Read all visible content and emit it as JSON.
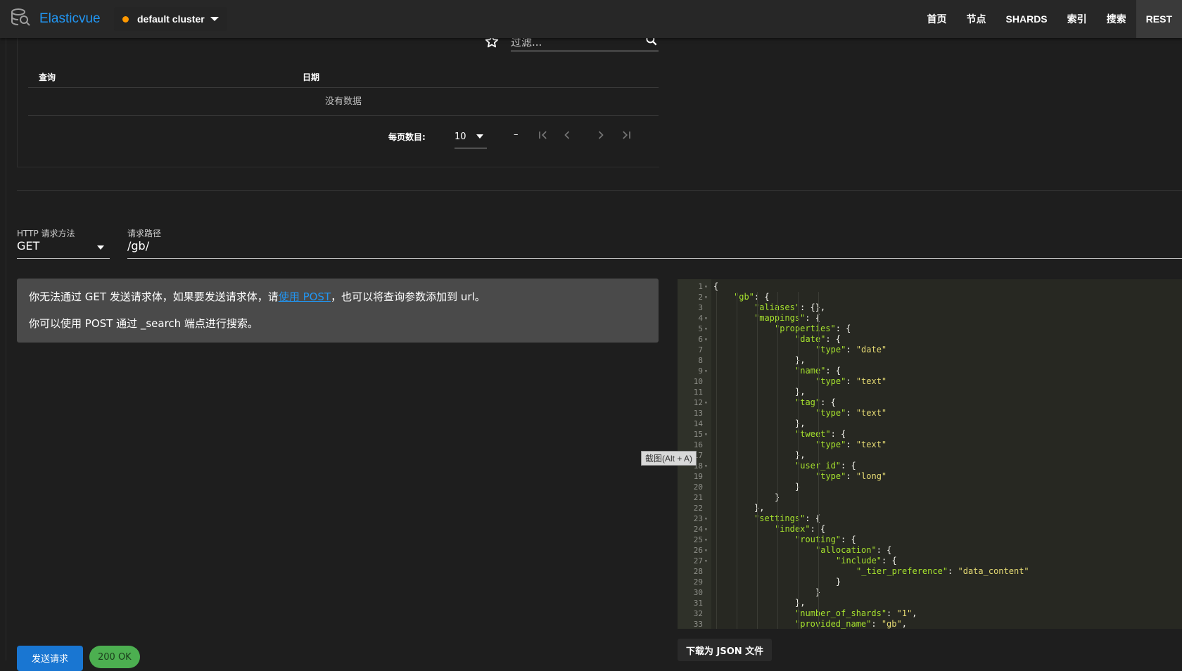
{
  "app": {
    "name": "Elasticvue",
    "cluster": "default cluster",
    "cluster_status_color": "#ff9800",
    "brand_color": "#2196f3"
  },
  "nav": [
    {
      "label": "首页",
      "active": false
    },
    {
      "label": "节点",
      "active": false
    },
    {
      "label": "SHARDS",
      "active": false
    },
    {
      "label": "索引",
      "active": false
    },
    {
      "label": "搜索",
      "active": false
    },
    {
      "label": "REST",
      "active": true
    }
  ],
  "history": {
    "filter_placeholder": "过滤...",
    "columns": [
      "查询",
      "日期"
    ],
    "empty_text": "没有数据",
    "per_page_label": "每页数目:",
    "per_page_value": "10",
    "range_text": "–"
  },
  "request": {
    "method_label": "HTTP 请求方法",
    "method_value": "GET",
    "path_label": "请求路径",
    "path_value": "/gb/"
  },
  "alert": {
    "line1_before": "你无法通过 GET 发送请求体，如果要发送请求体，请",
    "line1_link": "使用 POST",
    "line1_after": "，也可以将查询参数添加到 url。",
    "line2": "你可以使用 POST 通过 _search 端点进行搜索。"
  },
  "editor": {
    "lines": [
      {
        "n": "1",
        "fold": true,
        "ind": 0,
        "text": "{"
      },
      {
        "n": "2",
        "fold": true,
        "ind": 1,
        "key": "\"gb\"",
        "text": ": {"
      },
      {
        "n": "3",
        "fold": false,
        "ind": 2,
        "key": "\"aliases\"",
        "text": ": {},"
      },
      {
        "n": "4",
        "fold": true,
        "ind": 2,
        "key": "\"mappings\"",
        "text": ": {"
      },
      {
        "n": "5",
        "fold": true,
        "ind": 3,
        "key": "\"properties\"",
        "text": ": {"
      },
      {
        "n": "6",
        "fold": true,
        "ind": 4,
        "key": "\"date\"",
        "text": ": {"
      },
      {
        "n": "7",
        "fold": false,
        "ind": 5,
        "key": "\"type\"",
        "text": ": ",
        "str": "\"date\""
      },
      {
        "n": "8",
        "fold": false,
        "ind": 4,
        "text": "},"
      },
      {
        "n": "9",
        "fold": true,
        "ind": 4,
        "key": "\"name\"",
        "text": ": {"
      },
      {
        "n": "10",
        "fold": false,
        "ind": 5,
        "key": "\"type\"",
        "text": ": ",
        "str": "\"text\""
      },
      {
        "n": "11",
        "fold": false,
        "ind": 4,
        "text": "},"
      },
      {
        "n": "12",
        "fold": true,
        "ind": 4,
        "key": "\"tag\"",
        "text": ": {"
      },
      {
        "n": "13",
        "fold": false,
        "ind": 5,
        "key": "\"type\"",
        "text": ": ",
        "str": "\"text\""
      },
      {
        "n": "14",
        "fold": false,
        "ind": 4,
        "text": "},"
      },
      {
        "n": "15",
        "fold": true,
        "ind": 4,
        "key": "\"tweet\"",
        "text": ": {"
      },
      {
        "n": "16",
        "fold": false,
        "ind": 5,
        "key": "\"type\"",
        "text": ": ",
        "str": "\"text\""
      },
      {
        "n": "17",
        "fold": false,
        "ind": 4,
        "text": "},"
      },
      {
        "n": "18",
        "fold": true,
        "ind": 4,
        "key": "\"user_id\"",
        "text": ": {"
      },
      {
        "n": "19",
        "fold": false,
        "ind": 5,
        "key": "\"type\"",
        "text": ": ",
        "str": "\"long\""
      },
      {
        "n": "20",
        "fold": false,
        "ind": 4,
        "text": "}"
      },
      {
        "n": "21",
        "fold": false,
        "ind": 3,
        "text": "}"
      },
      {
        "n": "22",
        "fold": false,
        "ind": 2,
        "text": "},"
      },
      {
        "n": "23",
        "fold": true,
        "ind": 2,
        "key": "\"settings\"",
        "text": ": {"
      },
      {
        "n": "24",
        "fold": true,
        "ind": 3,
        "key": "\"index\"",
        "text": ": {"
      },
      {
        "n": "25",
        "fold": true,
        "ind": 4,
        "key": "\"routing\"",
        "text": ": {"
      },
      {
        "n": "26",
        "fold": true,
        "ind": 5,
        "key": "\"allocation\"",
        "text": ": {"
      },
      {
        "n": "27",
        "fold": true,
        "ind": 6,
        "key": "\"include\"",
        "text": ": {"
      },
      {
        "n": "28",
        "fold": false,
        "ind": 7,
        "key": "\"_tier_preference\"",
        "text": ": ",
        "str": "\"data_content\""
      },
      {
        "n": "29",
        "fold": false,
        "ind": 6,
        "text": "}"
      },
      {
        "n": "30",
        "fold": false,
        "ind": 5,
        "text": "}"
      },
      {
        "n": "31",
        "fold": false,
        "ind": 4,
        "text": "},"
      },
      {
        "n": "32",
        "fold": false,
        "ind": 4,
        "key": "\"number_of_shards\"",
        "text": ": ",
        "str": "\"1\"",
        "tail": ","
      },
      {
        "n": "33",
        "fold": false,
        "ind": 4,
        "key": "\"provided_name\"",
        "text": ": ",
        "str": "\"gb\"",
        "tail": ","
      }
    ]
  },
  "tooltip": "截图(Alt + A)",
  "actions": {
    "download_label": "下载为 JSON 文件",
    "send_label": "发送请求",
    "status_label": "200 OK",
    "status_color": "#4caf50",
    "send_color": "#1976d2"
  }
}
